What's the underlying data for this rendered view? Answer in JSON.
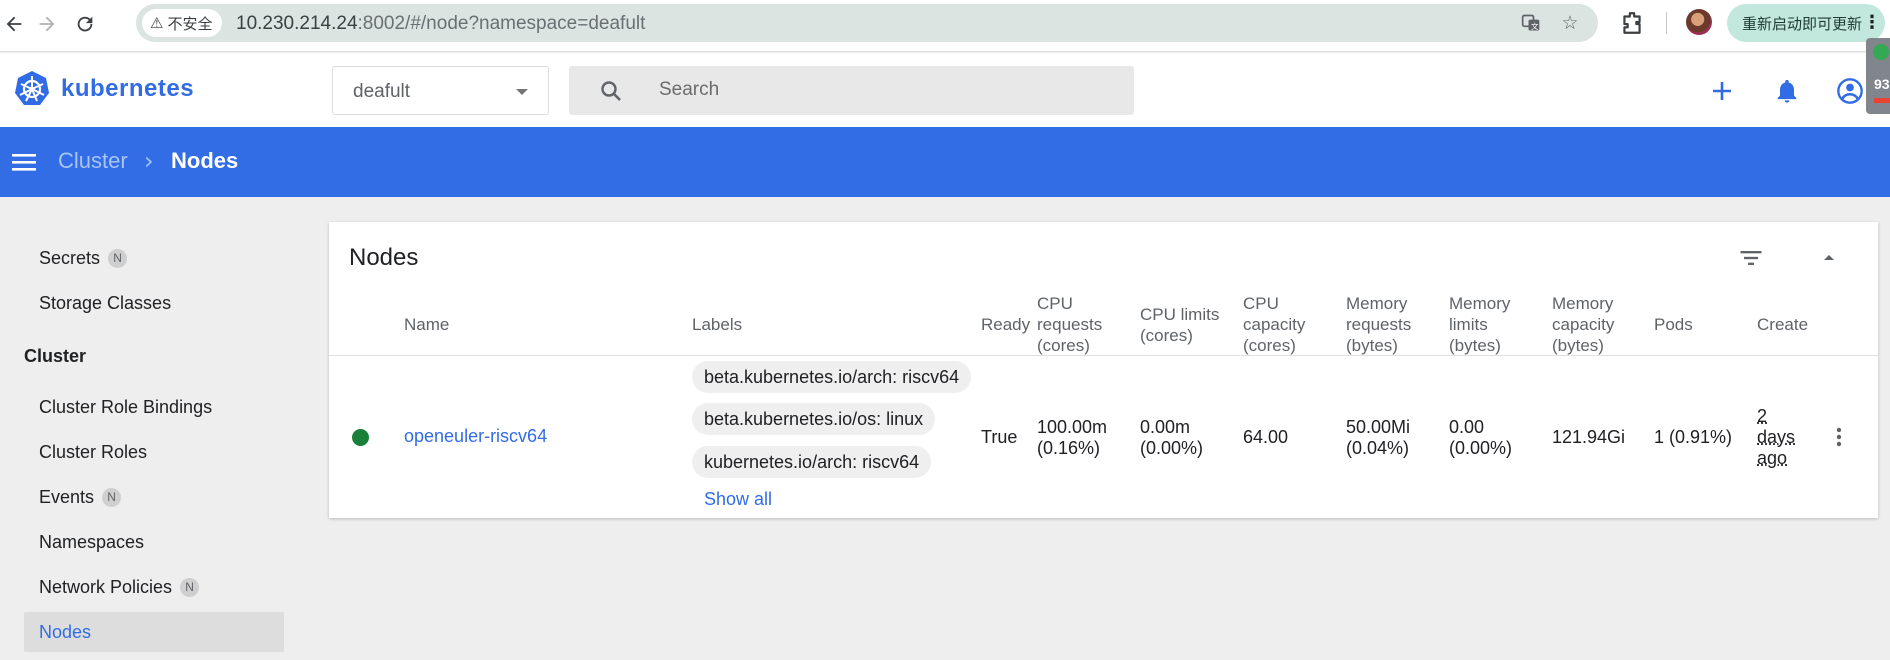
{
  "browser": {
    "back_icon": "arrow-left-icon",
    "security_label": "不安全",
    "url_host": "10.230.214.24",
    "url_rest": ":8002/#/node?namespace=deafult",
    "update_button": "重新启动即可更新",
    "scroll_counter": "93"
  },
  "header": {
    "brand": "kubernetes",
    "namespace_value": "deafult",
    "search_placeholder": "Search"
  },
  "toolbar": {
    "breadcrumb_parent": "Cluster",
    "breadcrumb_current": "Nodes"
  },
  "sidebar": {
    "items_top": [
      {
        "label": "Secrets",
        "badge": "N"
      },
      {
        "label": "Storage Classes",
        "badge": ""
      }
    ],
    "section_label": "Cluster",
    "items_cluster": [
      {
        "label": "Cluster Role Bindings",
        "badge": ""
      },
      {
        "label": "Cluster Roles",
        "badge": ""
      },
      {
        "label": "Events",
        "badge": "N"
      },
      {
        "label": "Namespaces",
        "badge": ""
      },
      {
        "label": "Network Policies",
        "badge": "N"
      },
      {
        "label": "Nodes",
        "badge": "",
        "active": true
      }
    ]
  },
  "card": {
    "title": "Nodes",
    "columns": {
      "name": "Name",
      "labels": "Labels",
      "ready": "Ready",
      "cpu_requests": [
        "CPU",
        "requests",
        "(cores)"
      ],
      "cpu_limits": [
        "CPU limits",
        "(cores)"
      ],
      "cpu_capacity": [
        "CPU",
        "capacity",
        "(cores)"
      ],
      "mem_requests": [
        "Memory",
        "requests",
        "(bytes)"
      ],
      "mem_limits": [
        "Memory",
        "limits",
        "(bytes)"
      ],
      "mem_capacity": [
        "Memory",
        "capacity",
        "(bytes)"
      ],
      "pods": "Pods",
      "created": "Create"
    },
    "rows": [
      {
        "status_color": "#188038",
        "name": "openeuler-riscv64",
        "labels": [
          "beta.kubernetes.io/arch: riscv64",
          "beta.kubernetes.io/os: linux",
          "kubernetes.io/arch: riscv64"
        ],
        "show_all": "Show all",
        "ready": "True",
        "cpu_requests": [
          "100.00m",
          "(0.16%)"
        ],
        "cpu_limits": [
          "0.00m",
          "(0.00%)"
        ],
        "cpu_capacity": "64.00",
        "mem_requests": [
          "50.00Mi",
          "(0.04%)"
        ],
        "mem_limits": [
          "0.00",
          "(0.00%)"
        ],
        "mem_capacity": "121.94Gi",
        "pods": "1 (0.91%)",
        "created": [
          "2",
          "days",
          "ago"
        ]
      }
    ]
  },
  "colors": {
    "brand_blue": "#326ce5",
    "toolbar_blue": "#326de6",
    "ready_green": "#188038"
  }
}
